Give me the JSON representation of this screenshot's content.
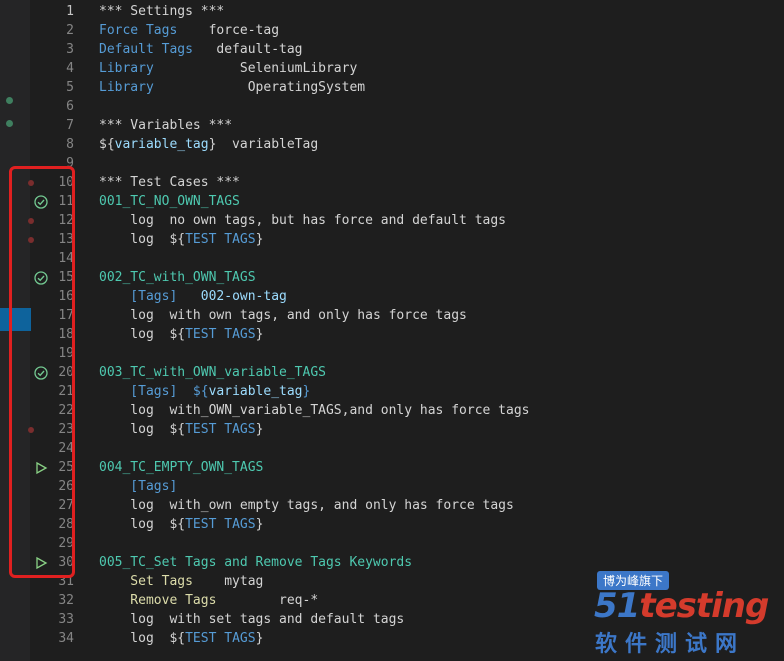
{
  "editor": {
    "lines": [
      {
        "n": "1",
        "active": true,
        "spans": [
          {
            "t": "*** Settings ***",
            "c": "hdr"
          }
        ]
      },
      {
        "n": "2",
        "spans": [
          {
            "t": "Force Tags",
            "c": "kw"
          },
          {
            "t": "    force-tag",
            "c": "plain"
          }
        ]
      },
      {
        "n": "3",
        "spans": [
          {
            "t": "Default Tags",
            "c": "kw"
          },
          {
            "t": "   default-tag",
            "c": "plain"
          }
        ]
      },
      {
        "n": "4",
        "spans": [
          {
            "t": "Library",
            "c": "kw"
          },
          {
            "t": "           SeleniumLibrary",
            "c": "plain"
          }
        ]
      },
      {
        "n": "5",
        "spans": [
          {
            "t": "Library",
            "c": "kw"
          },
          {
            "t": "            OperatingSystem",
            "c": "plain"
          }
        ]
      },
      {
        "n": "6",
        "spans": []
      },
      {
        "n": "7",
        "spans": [
          {
            "t": "*** Variables ***",
            "c": "hdr"
          }
        ]
      },
      {
        "n": "8",
        "spans": [
          {
            "t": "${",
            "c": "plain"
          },
          {
            "t": "variable_tag",
            "c": "var"
          },
          {
            "t": "}",
            "c": "plain"
          },
          {
            "t": "  variableTag",
            "c": "plain"
          }
        ]
      },
      {
        "n": "9",
        "spans": []
      },
      {
        "n": "10",
        "spans": [
          {
            "t": "*** Test Cases ***",
            "c": "hdr"
          }
        ]
      },
      {
        "n": "11",
        "icon": "check",
        "spans": [
          {
            "t": "001_TC_NO_OWN_TAGS",
            "c": "tc"
          }
        ]
      },
      {
        "n": "12",
        "spans": [
          {
            "t": "    log",
            "c": "plain"
          },
          {
            "t": "  no own tags, but has force and default tags",
            "c": "plain"
          }
        ]
      },
      {
        "n": "13",
        "spans": [
          {
            "t": "    log",
            "c": "plain"
          },
          {
            "t": "  ${",
            "c": "plain"
          },
          {
            "t": "TEST TAGS",
            "c": "kw"
          },
          {
            "t": "}",
            "c": "plain"
          }
        ]
      },
      {
        "n": "14",
        "spans": []
      },
      {
        "n": "15",
        "icon": "check",
        "spans": [
          {
            "t": "002_TC_with_OWN_TAGS",
            "c": "tc"
          }
        ]
      },
      {
        "n": "16",
        "spans": [
          {
            "t": "    [Tags]",
            "c": "kw"
          },
          {
            "t": "   002-own-tag",
            "c": "var"
          }
        ]
      },
      {
        "n": "17",
        "spans": [
          {
            "t": "    log",
            "c": "plain"
          },
          {
            "t": "  with own tags, and only has force tags",
            "c": "plain"
          }
        ]
      },
      {
        "n": "18",
        "spans": [
          {
            "t": "    log",
            "c": "plain"
          },
          {
            "t": "  ${",
            "c": "plain"
          },
          {
            "t": "TEST TAGS",
            "c": "kw"
          },
          {
            "t": "}",
            "c": "plain"
          }
        ]
      },
      {
        "n": "19",
        "spans": []
      },
      {
        "n": "20",
        "icon": "check",
        "spans": [
          {
            "t": "003_TC_with_OWN_variable_TAGS",
            "c": "tc"
          }
        ]
      },
      {
        "n": "21",
        "spans": [
          {
            "t": "    [Tags]",
            "c": "kw"
          },
          {
            "t": "  ${",
            "c": "kw"
          },
          {
            "t": "variable_tag",
            "c": "var"
          },
          {
            "t": "}",
            "c": "kw"
          }
        ]
      },
      {
        "n": "22",
        "spans": [
          {
            "t": "    log",
            "c": "plain"
          },
          {
            "t": "  with_OWN_variable_TAGS,and only has force tags",
            "c": "plain"
          }
        ]
      },
      {
        "n": "23",
        "spans": [
          {
            "t": "    log",
            "c": "plain"
          },
          {
            "t": "  ${",
            "c": "plain"
          },
          {
            "t": "TEST TAGS",
            "c": "kw"
          },
          {
            "t": "}",
            "c": "plain"
          }
        ]
      },
      {
        "n": "24",
        "spans": []
      },
      {
        "n": "25",
        "icon": "play",
        "spans": [
          {
            "t": "004_TC_EMPTY_OWN_TAGS",
            "c": "tc"
          }
        ]
      },
      {
        "n": "26",
        "spans": [
          {
            "t": "    [Tags]",
            "c": "kw"
          }
        ]
      },
      {
        "n": "27",
        "spans": [
          {
            "t": "    log",
            "c": "plain"
          },
          {
            "t": "  with_own empty tags, and only has force tags",
            "c": "plain"
          }
        ]
      },
      {
        "n": "28",
        "spans": [
          {
            "t": "    log",
            "c": "plain"
          },
          {
            "t": "  ${",
            "c": "plain"
          },
          {
            "t": "TEST TAGS",
            "c": "kw"
          },
          {
            "t": "}",
            "c": "plain"
          }
        ]
      },
      {
        "n": "29",
        "spans": []
      },
      {
        "n": "30",
        "icon": "play",
        "spans": [
          {
            "t": "005_TC_Set Tags and Remove Tags Keywords",
            "c": "tc"
          }
        ]
      },
      {
        "n": "31",
        "spans": [
          {
            "t": "    Set Tags",
            "c": "yellow"
          },
          {
            "t": "    mytag",
            "c": "plain"
          }
        ]
      },
      {
        "n": "32",
        "spans": [
          {
            "t": "    Remove Tags",
            "c": "yellow"
          },
          {
            "t": "        req-*",
            "c": "plain"
          }
        ]
      },
      {
        "n": "33",
        "spans": [
          {
            "t": "    log",
            "c": "plain"
          },
          {
            "t": "  with set tags and default tags",
            "c": "plain"
          }
        ]
      },
      {
        "n": "34",
        "spans": [
          {
            "t": "    log",
            "c": "plain"
          },
          {
            "t": "  ${",
            "c": "plain"
          },
          {
            "t": "TEST TAGS",
            "c": "kw"
          },
          {
            "t": "}",
            "c": "plain"
          }
        ]
      }
    ]
  },
  "icons": {
    "check": "check-circle-icon",
    "play": "run-test-icon"
  },
  "colors": {
    "highlight": "#e02020",
    "pass": "#73c991",
    "run": "#89d185"
  },
  "watermark": {
    "tag": "博为峰旗下",
    "logo_a": "51",
    "logo_b": "testing",
    "sub": "软件测试网"
  }
}
